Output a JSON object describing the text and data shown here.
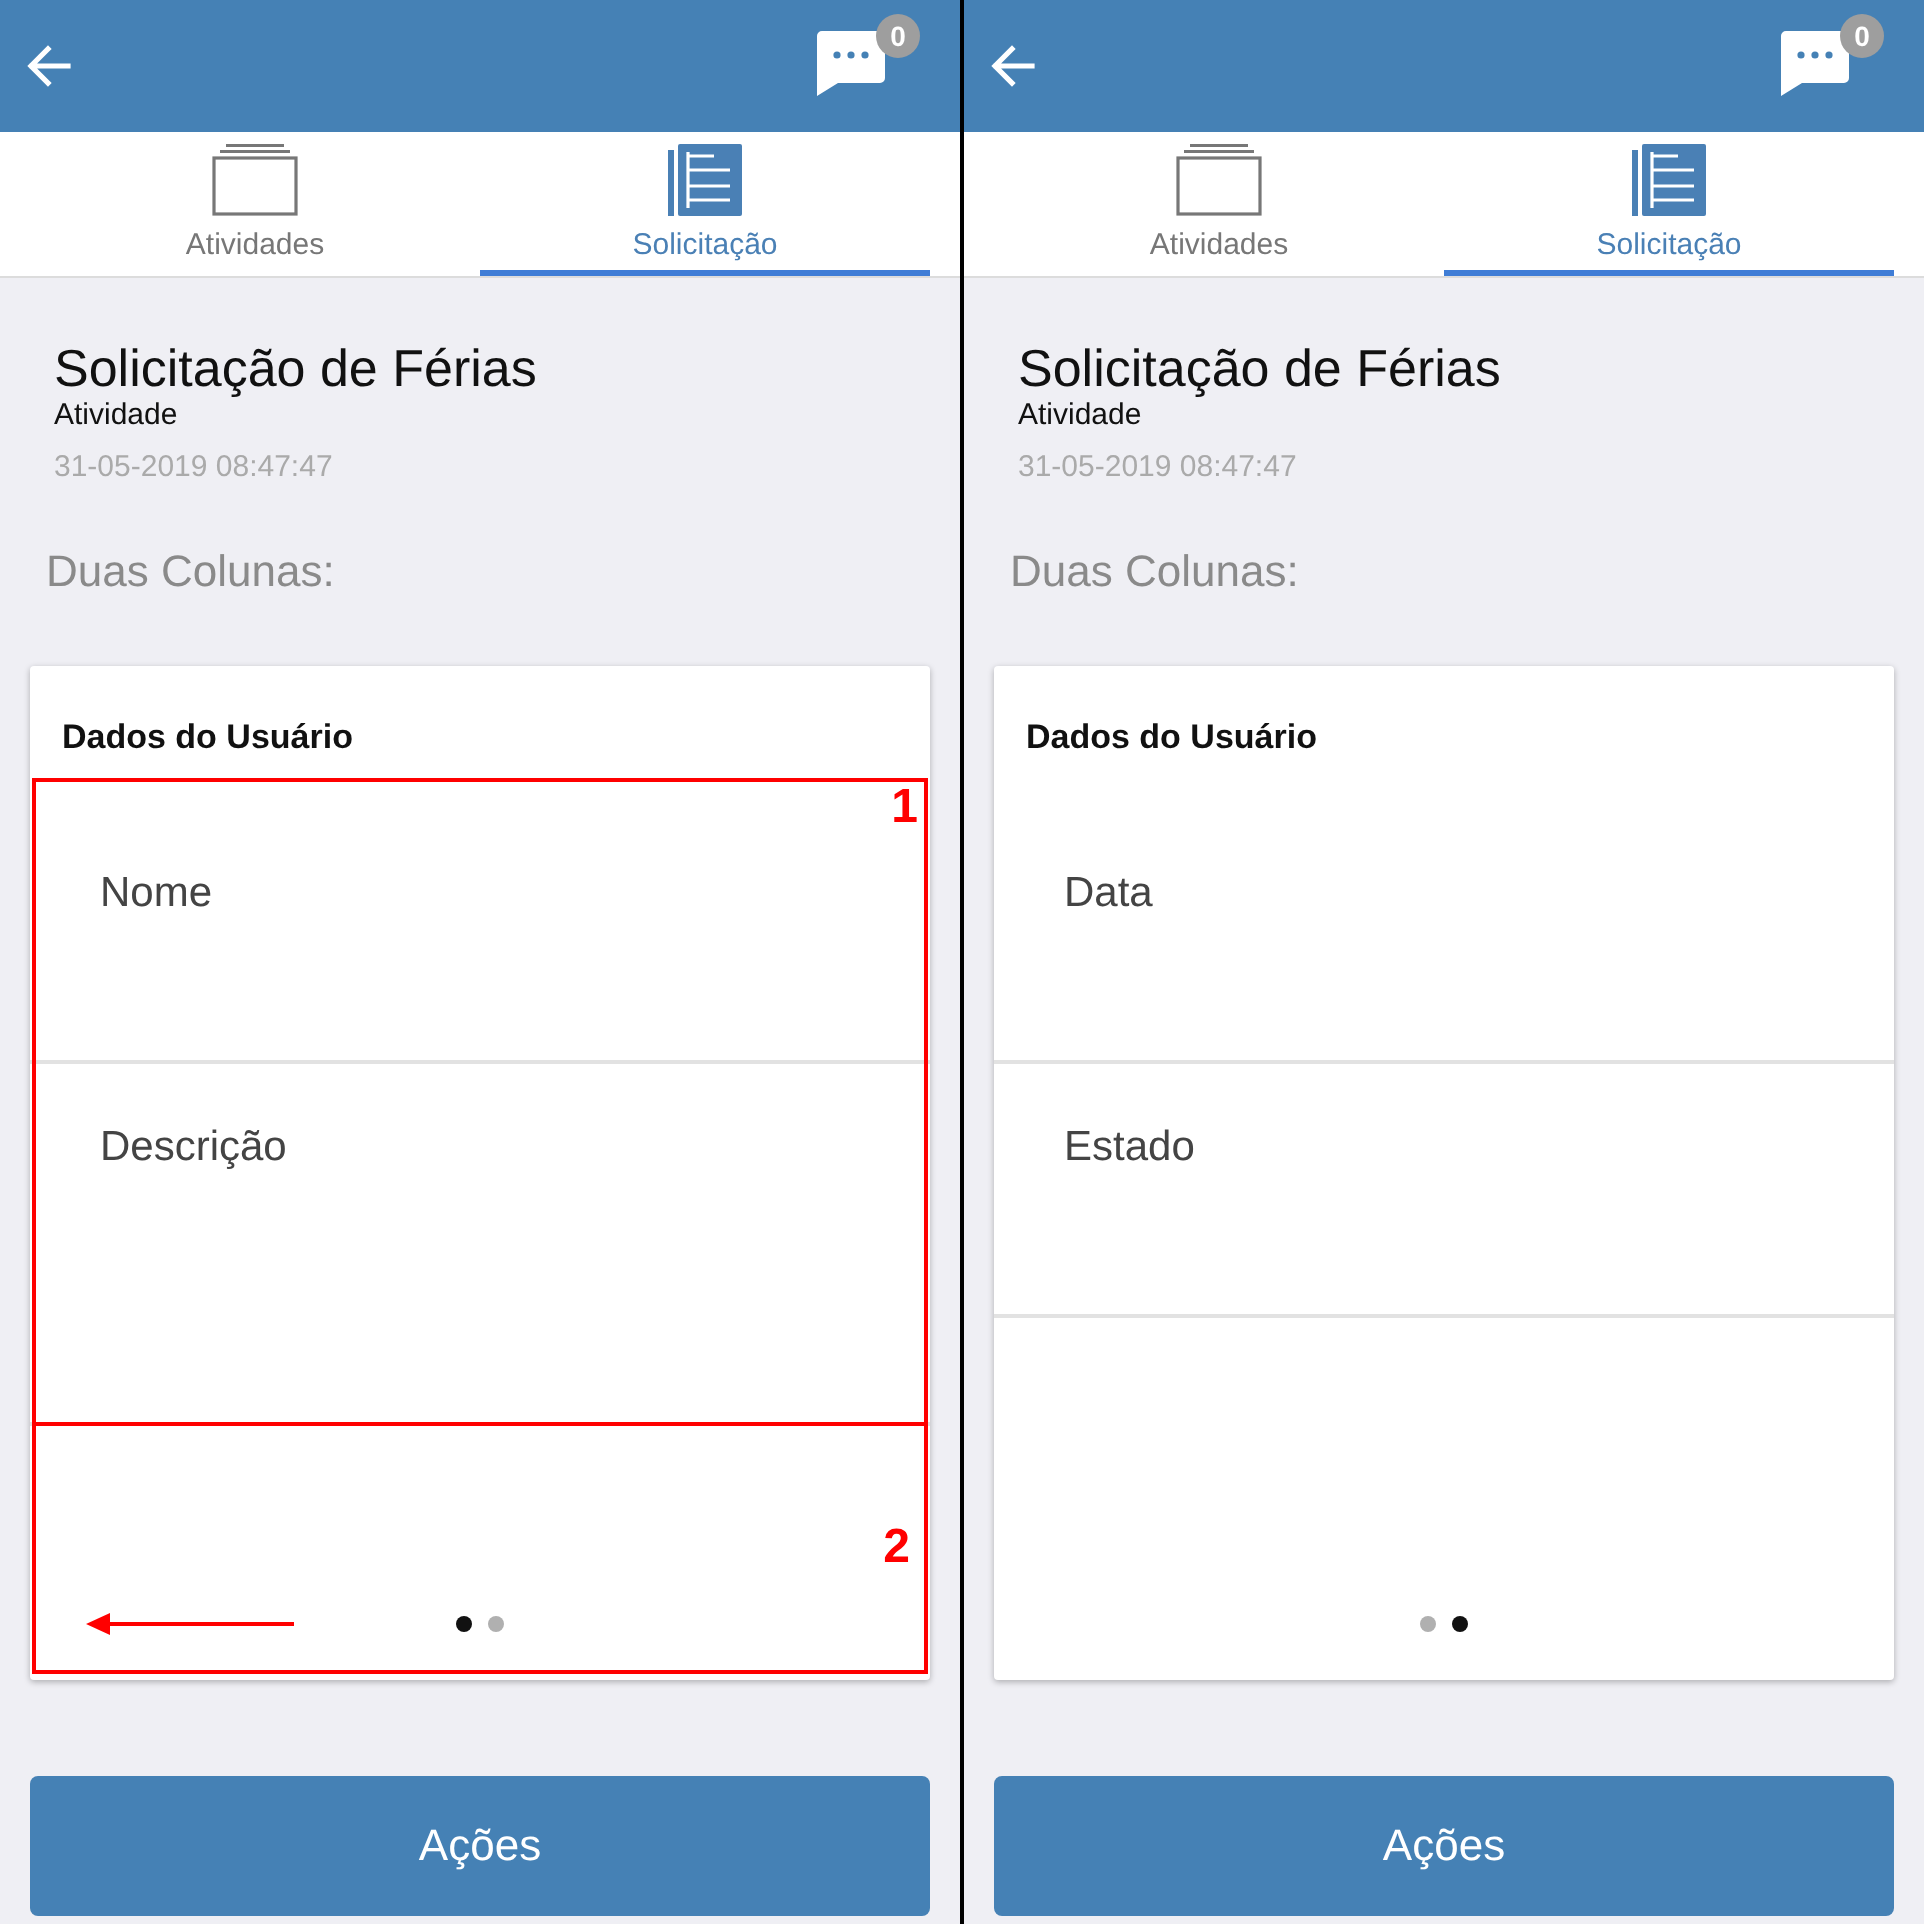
{
  "screens": [
    {
      "header": {
        "badge": "0"
      },
      "tabs": [
        {
          "label": "Atividades",
          "selected": false
        },
        {
          "label": "Solicitação",
          "selected": true
        }
      ],
      "title": "Solicitação de Férias",
      "subtitle": "Atividade",
      "timestamp": "31-05-2019 08:47:47",
      "section_label": "Duas Colunas:",
      "card": {
        "title": "Dados do Usuário",
        "fields": [
          {
            "label": "Nome",
            "kind": "text"
          },
          {
            "label": "Descrição",
            "kind": "textarea"
          }
        ],
        "fields_box": {
          "label": "1"
        },
        "pages": [
          {
            "selected": true
          },
          {
            "selected": false
          }
        ],
        "pages_box": {
          "label": "2"
        },
        "swipe_arrow": true
      },
      "action_button": "Ações"
    },
    {
      "header": {
        "badge": "0"
      },
      "tabs": [
        {
          "label": "Atividades",
          "selected": false
        },
        {
          "label": "Solicitação",
          "selected": true
        }
      ],
      "title": "Solicitação de Férias",
      "subtitle": "Atividade",
      "timestamp": "31-05-2019 08:47:47",
      "section_label": "Duas Colunas:",
      "card": {
        "title": "Dados do Usuário",
        "fields": [
          {
            "label": "Data",
            "kind": "text"
          },
          {
            "label": "Estado",
            "kind": "text"
          }
        ],
        "pages": [
          {
            "selected": false
          },
          {
            "selected": true
          }
        ]
      },
      "action_button": "Ações"
    }
  ]
}
